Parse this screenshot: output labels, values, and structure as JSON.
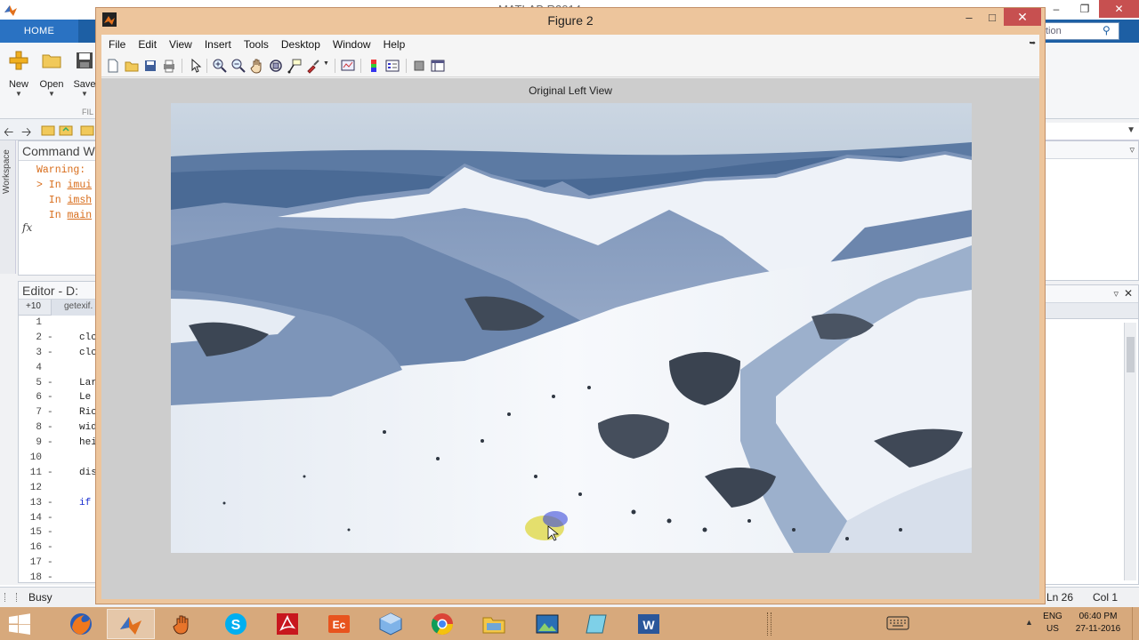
{
  "matlab": {
    "title": "MATLAB R2014",
    "home_tab": "HOME",
    "search_placeholder": "tion",
    "ribbon": {
      "new_label": "New",
      "open_label": "Open",
      "save_label": "Save",
      "group_label": "FIL"
    },
    "command_window": {
      "title": "Command W",
      "lines": [
        {
          "prefix": "",
          "text": "Warning:"
        },
        {
          "prefix": "> In ",
          "text": "imui"
        },
        {
          "prefix": "  In ",
          "text": "imsh"
        },
        {
          "prefix": "  In ",
          "text": "main"
        }
      ],
      "prompt": "fx"
    },
    "workspace_label": "Workspace",
    "editor": {
      "title": "Editor - D:",
      "tab_plus": "+10",
      "tab_file": "getexif.",
      "lines": [
        {
          "num": "1",
          "dash": "",
          "code": ""
        },
        {
          "num": "2",
          "dash": "-",
          "code": "clc"
        },
        {
          "num": "3",
          "dash": "-",
          "code": "clc"
        },
        {
          "num": "4",
          "dash": "",
          "code": ""
        },
        {
          "num": "5",
          "dash": "-",
          "code": "Lar"
        },
        {
          "num": "6",
          "dash": "-",
          "code": "Le"
        },
        {
          "num": "7",
          "dash": "-",
          "code": "Ric"
        },
        {
          "num": "8",
          "dash": "-",
          "code": "wid"
        },
        {
          "num": "9",
          "dash": "-",
          "code": "hei"
        },
        {
          "num": "10",
          "dash": "",
          "code": ""
        },
        {
          "num": "11",
          "dash": "-",
          "code": "dis"
        },
        {
          "num": "12",
          "dash": "",
          "code": ""
        },
        {
          "num": "13",
          "dash": "-",
          "code": "if",
          "kw": true
        },
        {
          "num": "14",
          "dash": "-",
          "code": ""
        },
        {
          "num": "15",
          "dash": "-",
          "code": ""
        },
        {
          "num": "16",
          "dash": "-",
          "code": ""
        },
        {
          "num": "17",
          "dash": "-",
          "code": ""
        },
        {
          "num": "18",
          "dash": "-",
          "code": ""
        }
      ]
    },
    "status": {
      "busy": "Busy",
      "ln": "Ln  26",
      "col": "Col  1"
    }
  },
  "figure": {
    "title": "Figure 2",
    "menu": [
      "File",
      "Edit",
      "View",
      "Insert",
      "Tools",
      "Desktop",
      "Window",
      "Help"
    ],
    "toolbar_icons": [
      "new-figure-icon",
      "open-file-icon",
      "save-figure-icon",
      "print-figure-icon",
      "edit-plot-icon",
      "zoom-in-icon",
      "zoom-out-icon",
      "pan-icon",
      "rotate-3d-icon",
      "data-cursor-icon",
      "brush-icon",
      "link-plot-icon",
      "colorbar-icon",
      "legend-icon",
      "hide-plot-tools-icon",
      "show-plot-tools-icon"
    ],
    "axes_title": "Original Left View"
  },
  "taskbar": {
    "apps": [
      "firefox-icon",
      "matlab-icon",
      "hand-app-icon",
      "skype-icon",
      "acrobat-icon",
      "presenter-icon",
      "box-app-icon",
      "chrome-icon",
      "file-explorer-icon",
      "photo-viewer-icon",
      "notepad-icon",
      "word-icon"
    ],
    "lang_top": "ENG",
    "lang_bottom": "US",
    "time": "06:40 PM",
    "date": "27-11-2016"
  },
  "colors": {
    "ribbon_blue": "#1d5fa4",
    "figure_frame": "#edc59c",
    "close_red": "#c75050",
    "warning_orange": "#d86c1a",
    "taskbar": "#d7a97c"
  }
}
